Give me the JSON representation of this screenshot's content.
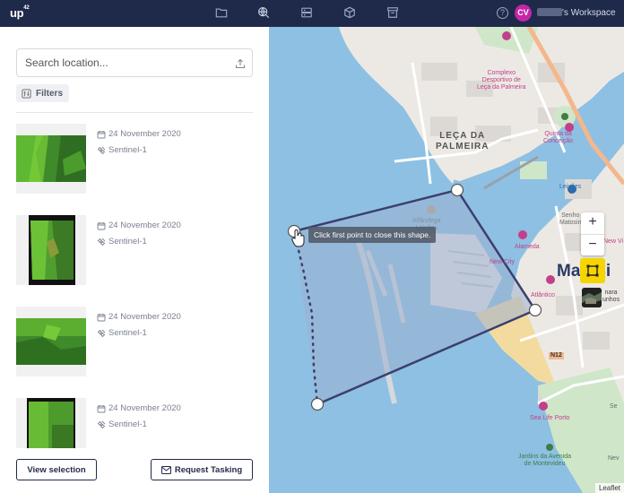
{
  "app": {
    "logo": "up",
    "logo_sup": "42",
    "avatar_initials": "CV",
    "workspace_suffix": "'s Workspace",
    "help_label": "?"
  },
  "nav_icons": [
    "folder-icon",
    "globe-search-icon",
    "storage-icon",
    "cube-icon",
    "archive-icon"
  ],
  "search": {
    "placeholder": "Search location..."
  },
  "filters": {
    "label": "Filters"
  },
  "results": [
    {
      "date": "24 November 2020",
      "sensor": "Sentinel-1"
    },
    {
      "date": "24 November 2020",
      "sensor": "Sentinel-1"
    },
    {
      "date": "24 November 2020",
      "sensor": "Sentinel-1"
    },
    {
      "date": "24 November 2020",
      "sensor": "Sentinel-1"
    }
  ],
  "buttons": {
    "view_selection": "View selection",
    "request_tasking": "Request Tasking"
  },
  "map": {
    "tooltip": "Click first point to close this shape.",
    "zoom_in": "+",
    "zoom_out": "−",
    "attribution": "Leaflet",
    "labels": {
      "leca_palmeira": "LEÇA DA\nPALMEIRA",
      "complexo": "Complexo\nDesportivo de\nLeça da Palmeira",
      "quinta": "Quinta da\nConceição",
      "leixoes": "Leixões",
      "senhora": "Senho\nMatosin",
      "alfandega": "Alfândega\nLeixões",
      "alameda": "Alameda",
      "new_city": "New City",
      "atlantico": "Atlântico",
      "matosinhos": "Matosi",
      "n12": "N12",
      "sea_life": "Sea Life Porto",
      "jardins": "Jardins da Avenida\nde Montevideu",
      "new_vi": "New Vi",
      "ara_nhos": "nara\nunhos",
      "sea_hint": "Se",
      "nev": "Nev"
    },
    "colors": {
      "sea": "#8dc0e3",
      "land": "#ece9e4",
      "polygon_stroke": "#3c3f6e",
      "polygon_fill": "#9fb0d0",
      "highlight": "#f5d400"
    }
  }
}
